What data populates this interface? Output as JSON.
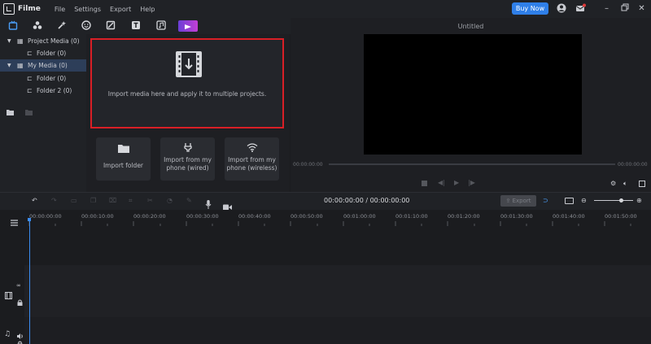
{
  "app": {
    "name": "Filme"
  },
  "menu": [
    "File",
    "Settings",
    "Export",
    "Help"
  ],
  "buy_now": "Buy Now",
  "tree": {
    "project_media": "Project Media (0)",
    "project_folder": "Folder (0)",
    "my_media": "My Media (0)",
    "my_folder": "Folder (0)",
    "my_folder2": "Folder 2 (0)"
  },
  "import": {
    "hint": "Import media here and apply it to multiple projects.",
    "folder": "Import folder",
    "wired": [
      "Import from my",
      "phone (wired)"
    ],
    "wireless": [
      "Import from my",
      "phone (wireless)"
    ]
  },
  "preview": {
    "title": "Untitled",
    "time_left": "00:00:00:00",
    "time_right": "00:00:00:00"
  },
  "timeline": {
    "timecode": "00:00:00:00 / 00:00:00:00",
    "export": "Export",
    "ticks": [
      "00:00:00:00",
      "00:00:10:00",
      "00:00:20:00",
      "00:00:30:00",
      "00:00:40:00",
      "00:00:50:00",
      "00:01:00:00",
      "00:01:10:00",
      "00:01:20:00",
      "00:01:30:00",
      "00:01:40:00",
      "00:01:50:00"
    ]
  },
  "colors": {
    "accent": "#2f7fe8",
    "highlight": "#d91f26",
    "selected": "#2d3e59"
  }
}
